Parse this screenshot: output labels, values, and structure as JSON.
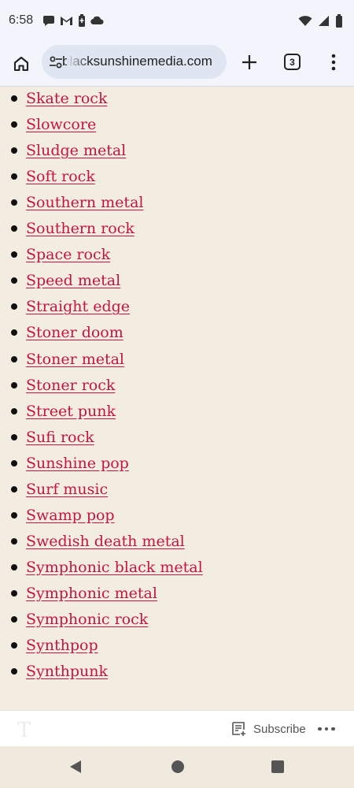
{
  "status_bar": {
    "time": "6:58",
    "left_icons": [
      "chat-icon",
      "gmail-icon",
      "battery-saver-icon",
      "cloud-icon"
    ],
    "right_icons": [
      "wifi-icon",
      "signal-icon",
      "battery-icon"
    ]
  },
  "browser": {
    "url": "blacksunshinemedia.com",
    "tab_count": "3",
    "icons": [
      "home-icon",
      "tune-icon",
      "new-tab-icon",
      "more-vert-icon"
    ]
  },
  "genres": [
    "Skate rock",
    "Slowcore",
    "Sludge metal",
    "Soft rock",
    "Southern metal",
    "Southern rock",
    "Space rock",
    "Speed metal",
    "Straight edge",
    "Stoner doom",
    "Stoner metal",
    "Stoner rock",
    "Street punk",
    "Sufi rock",
    "Sunshine pop",
    "Surf music",
    "Swamp pop",
    "Swedish death metal",
    "Symphonic black metal",
    "Symphonic metal",
    "Symphonic rock",
    "Synthpop",
    "Synthpunk"
  ],
  "subscribe_bar": {
    "subscribe_label": "Subscribe"
  },
  "colors": {
    "link": "#c4163d",
    "page_background": "#f3ede1",
    "chrome_background": "#f2f5fc"
  }
}
